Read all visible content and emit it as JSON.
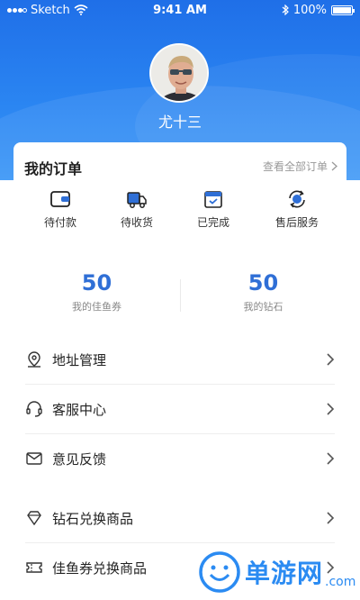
{
  "status_bar": {
    "carrier": "Sketch",
    "time": "9:41 AM",
    "battery": "100%",
    "battery_level": 1.0
  },
  "profile": {
    "username": "尤十三"
  },
  "orders": {
    "title": "我的订单",
    "view_all": "查看全部订单",
    "items": [
      {
        "label": "待付款",
        "icon": "wallet-icon"
      },
      {
        "label": "待收货",
        "icon": "truck-icon"
      },
      {
        "label": "已完成",
        "icon": "box-check-icon"
      },
      {
        "label": "售后服务",
        "icon": "service-cycle-icon"
      }
    ]
  },
  "stats": [
    {
      "value": "50",
      "label": "我的佳鱼券"
    },
    {
      "value": "50",
      "label": "我的钻石"
    }
  ],
  "menu": [
    {
      "label": "地址管理",
      "icon": "location-pin-icon"
    },
    {
      "label": "客服中心",
      "icon": "headset-icon"
    },
    {
      "label": "意见反馈",
      "icon": "mail-icon"
    },
    {
      "label": "钻石兑换商品",
      "icon": "diamond-icon"
    },
    {
      "label": "佳鱼券兑换商品",
      "icon": "ticket-icon"
    }
  ],
  "watermark": {
    "text": "单游网",
    "suffix": ".com"
  },
  "colors": {
    "header_blue": "#1f6fe8",
    "accent_blue": "#2f6fd6",
    "watermark_blue": "#2b8bf2"
  }
}
